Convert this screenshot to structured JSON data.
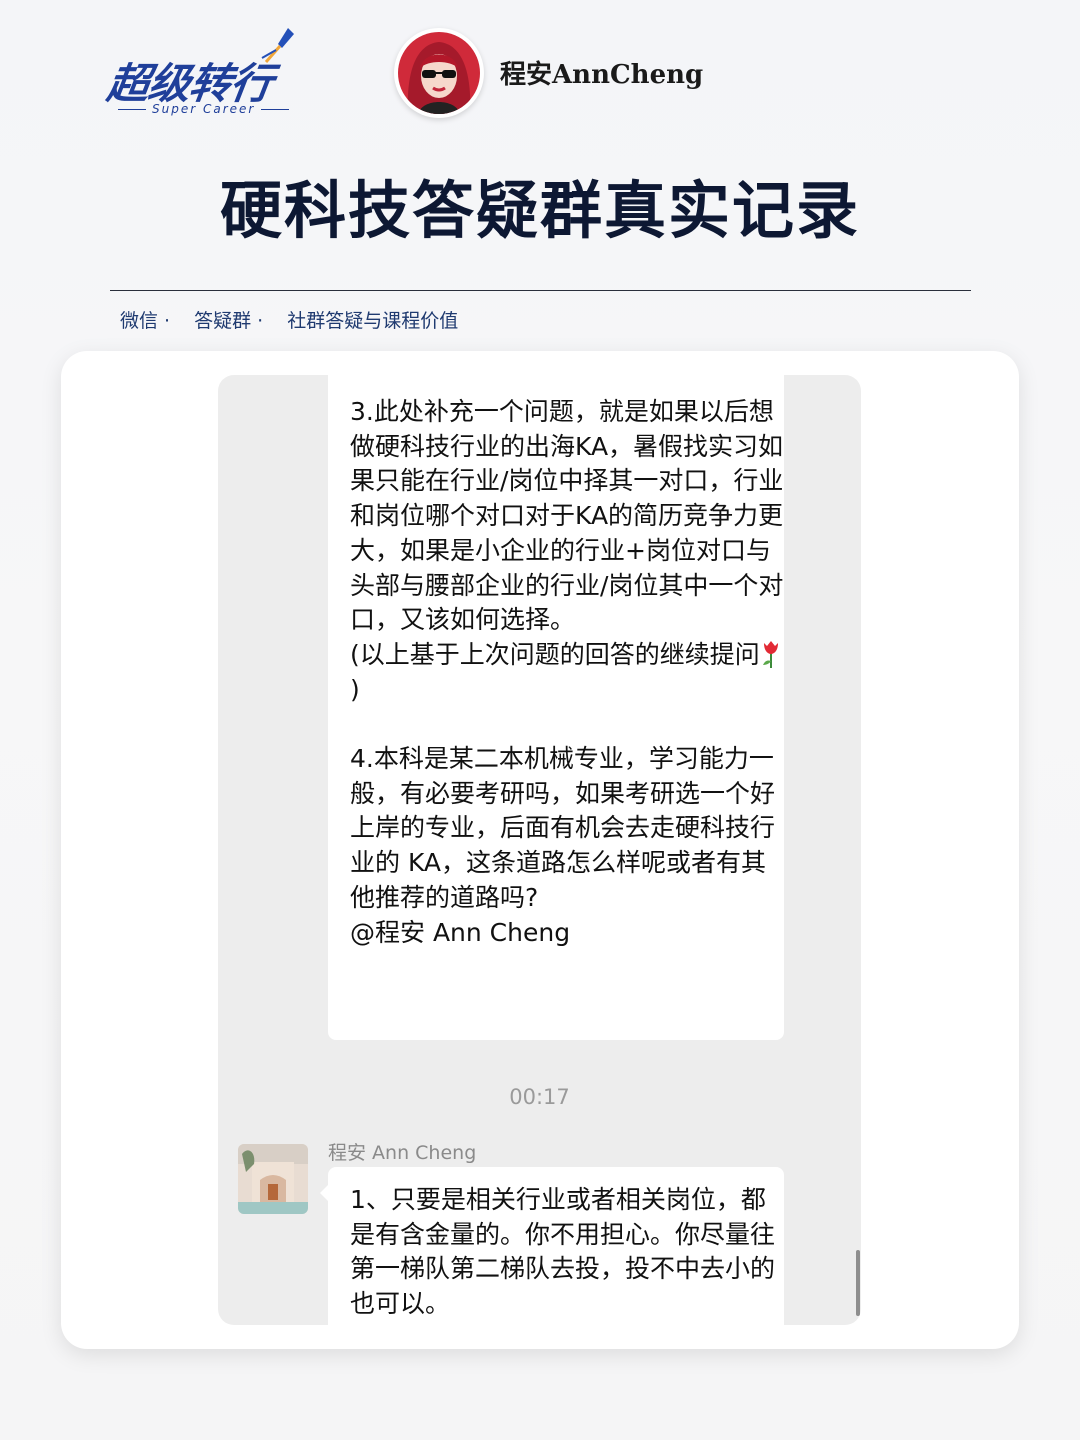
{
  "brand": {
    "name": "超级转行",
    "subtitle": "Super Career",
    "color": "#1f3f9a"
  },
  "author": {
    "name": "程安AnnCheng"
  },
  "title": "硬科技答疑群真实记录",
  "tags": [
    "微信 ·",
    "答疑群 ·",
    "社群答疑与课程价值"
  ],
  "chat": {
    "message_1_text": "3.此处补充一个问题，就是如果以后想做硬科技行业的出海KA，暑假找实习如果只能在行业/岗位中择其一对口，行业和岗位哪个对口对于KA的简历竞争力更大，如果是小企业的行业+岗位对口与头部与腰部企业的行业/岗位其中一个对口，又该如何选择。\n(以上基于上次问题的回答的继续提问",
    "message_1_emoji": "tulip-emoji",
    "message_1_close": ")",
    "message_1_text_2": "4.本科是某二本机械专业，学习能力一般，有必要考研吗，如果考研选一个好上岸的专业，后面有机会去走硬科技行业的 KA，这条道路怎么样呢或者有其他推荐的道路吗?\n@程安 Ann Cheng",
    "timestamp": "00:17",
    "reply_sender": "程安 Ann Cheng",
    "reply_text": "1、只要是相关行业或者相关岗位，都是有含金量的。你不用担心。你尽量往第一梯队第二梯队去投，投不中去小的也可以。"
  }
}
